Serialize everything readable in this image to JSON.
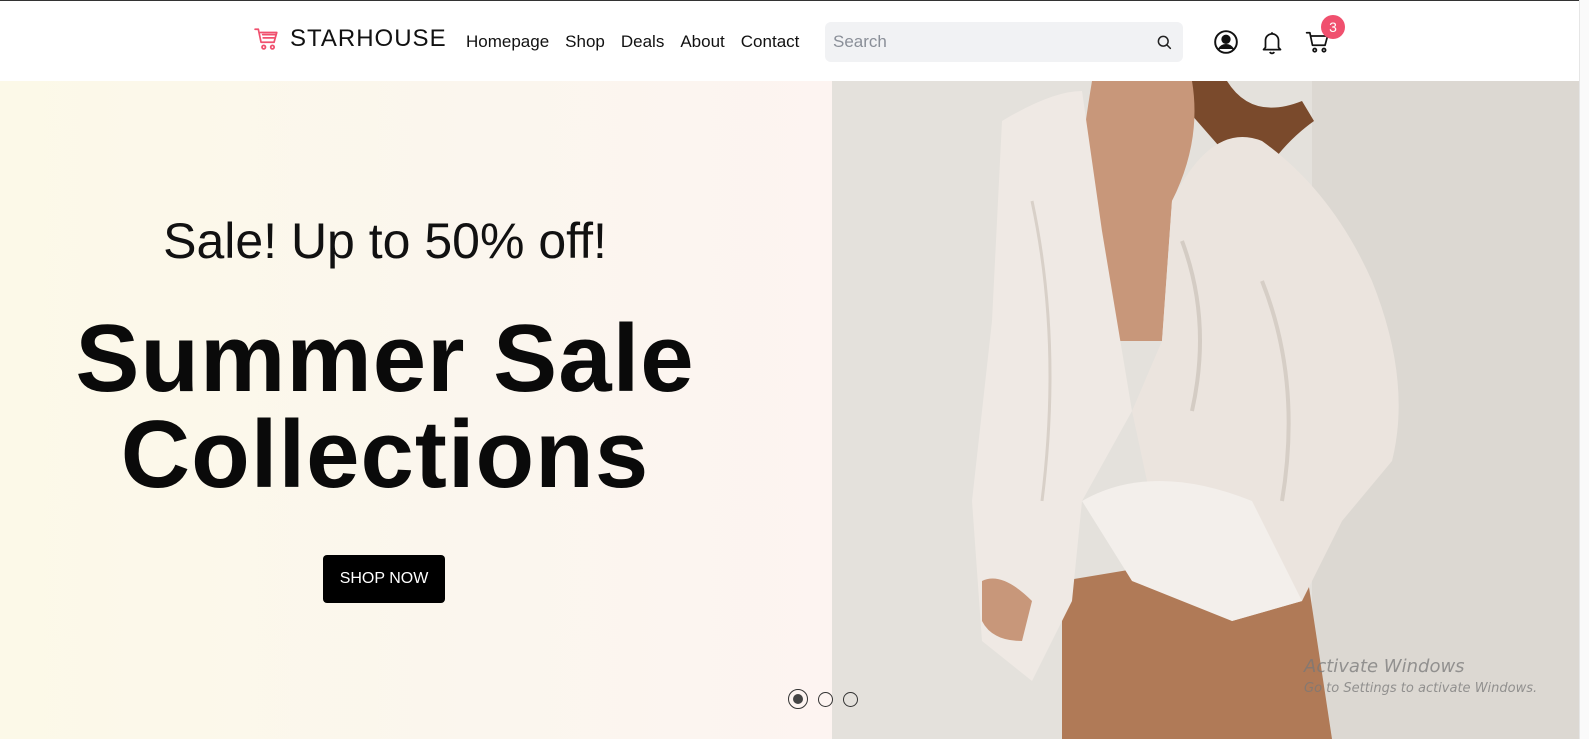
{
  "header": {
    "brand": {
      "name": "STARHOUSE",
      "logo_icon": "shopping-cart-icon",
      "logo_color": "#f0506e"
    },
    "nav": [
      {
        "label": "Homepage"
      },
      {
        "label": "Shop"
      },
      {
        "label": "Deals"
      },
      {
        "label": "About"
      },
      {
        "label": "Contact"
      }
    ],
    "search": {
      "placeholder": "Search",
      "value": "",
      "icon": "search-icon"
    },
    "actions": {
      "user_icon": "user-circle-icon",
      "notification_icon": "bell-icon",
      "cart_icon": "cart-icon",
      "cart_count": "3",
      "badge_color": "#f0506e"
    }
  },
  "hero": {
    "subheading": "Sale! Up to 50% off!",
    "headline_line1": "Summer Sale",
    "headline_line2": "Collections",
    "cta_label": "SHOP NOW",
    "slides": 3,
    "active_slide": 1,
    "image_alt": "woman in loose white linen shirt"
  },
  "overlay": {
    "title": "Activate Windows",
    "subtitle": "Go to Settings to activate Windows."
  }
}
